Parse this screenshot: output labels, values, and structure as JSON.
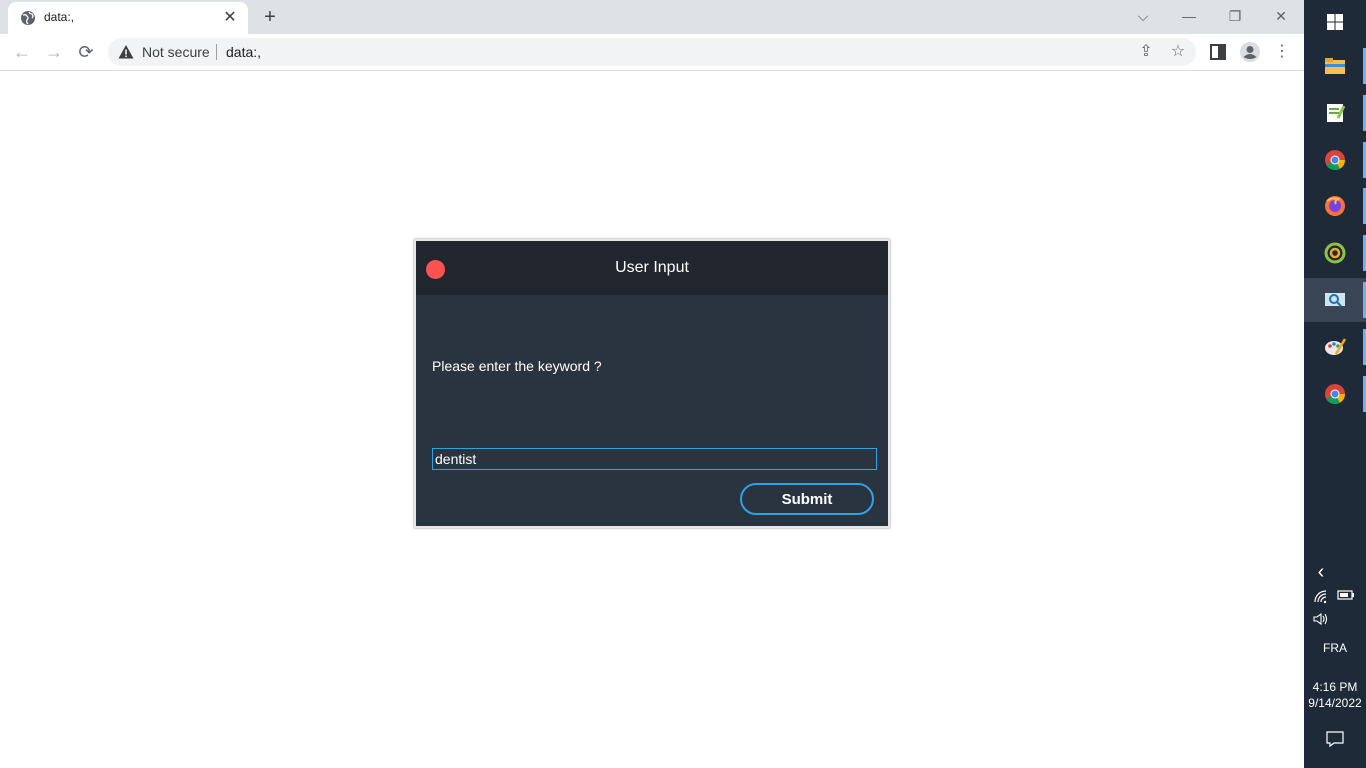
{
  "browser": {
    "tab": {
      "title": "data:,",
      "close_glyph": "✕"
    },
    "new_tab_glyph": "+",
    "window_controls": {
      "tab_search": "⌵",
      "minimize": "—",
      "restore": "❐",
      "close": "✕"
    },
    "toolbar": {
      "back_glyph": "←",
      "forward_glyph": "→",
      "reload_glyph": "⟳",
      "security_label": "Not secure",
      "url": "data:,",
      "share_glyph": "⇪",
      "bookmark_glyph": "☆",
      "menu_glyph": "⋮"
    }
  },
  "dialog": {
    "title": "User Input",
    "prompt": "Please enter the keyword ?",
    "input_value": "dentist",
    "submit_label": "Submit",
    "close_color": "#ff5252",
    "accent_color": "#2ea3e0",
    "background_color": "#2a3340",
    "header_color": "#21262f"
  },
  "taskbar": {
    "apps": [
      {
        "name": "windows-start-icon"
      },
      {
        "name": "file-explorer-icon"
      },
      {
        "name": "notepad-plus-icon"
      },
      {
        "name": "chrome-icon"
      },
      {
        "name": "firefox-icon"
      },
      {
        "name": "chameleon-app-icon"
      },
      {
        "name": "screen-capture-icon"
      },
      {
        "name": "paint-icon"
      },
      {
        "name": "chrome-icon"
      }
    ],
    "tray": {
      "chevron_glyph": "‹",
      "language": "FRA",
      "time": "4:16 PM",
      "date": "9/14/2022"
    }
  }
}
